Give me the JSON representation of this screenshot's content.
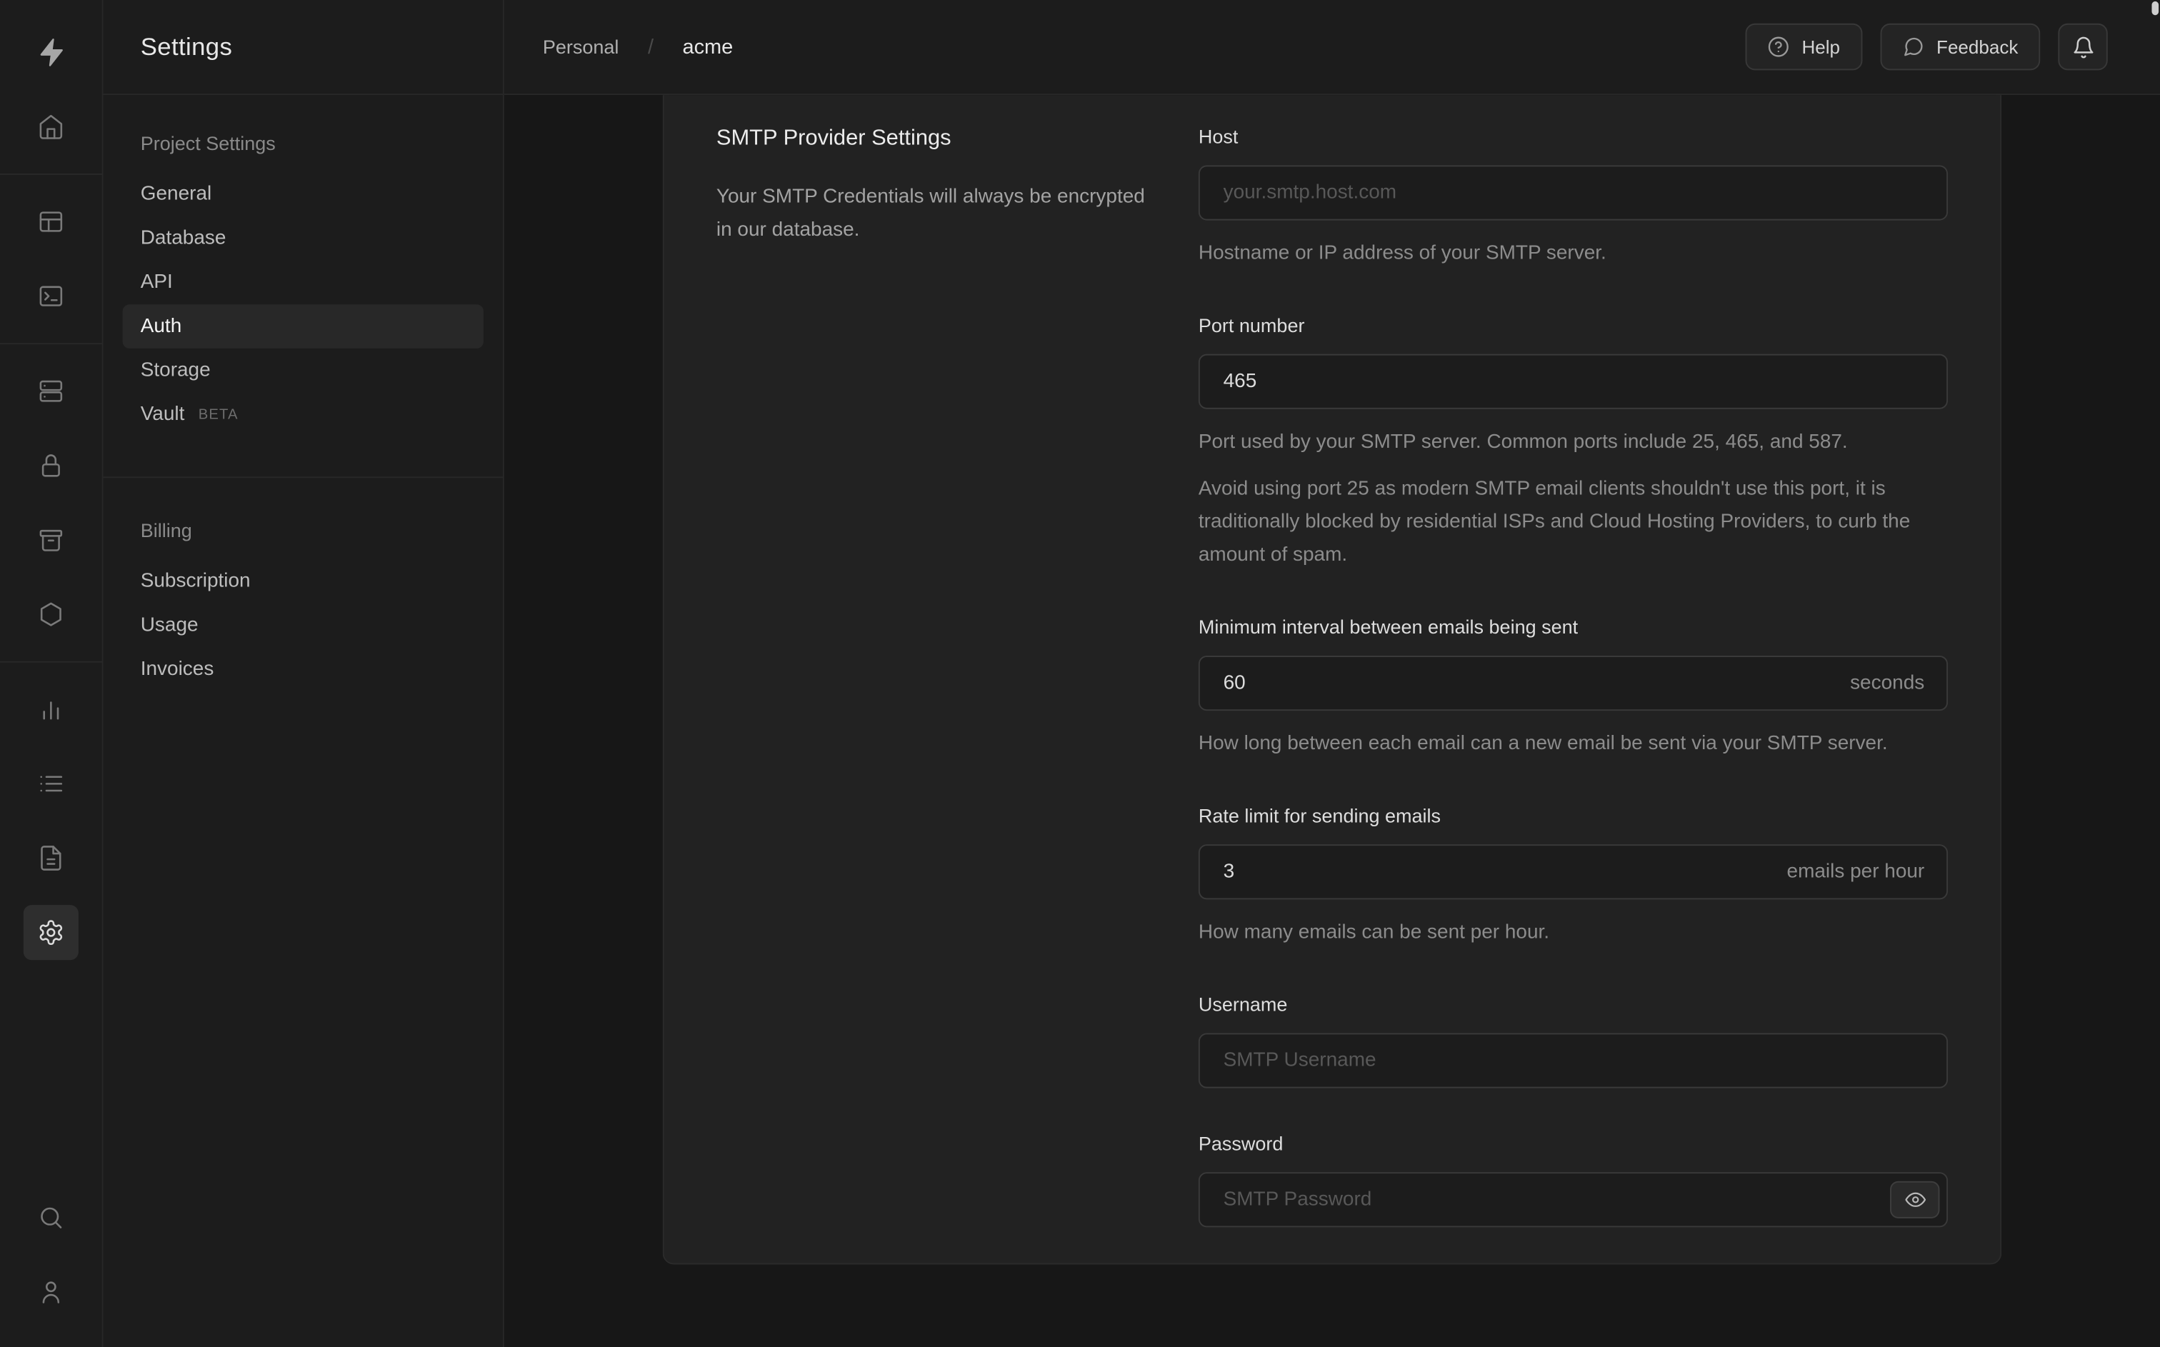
{
  "meta": {
    "app": "Supabase Dashboard",
    "page": "Project Settings - Auth - SMTP"
  },
  "colors": {
    "rail_bg": "#1c1c1c",
    "sidebar_bg": "#1c1c1c",
    "content_bg": "#171717",
    "card_bg": "#222222",
    "border": "#282828",
    "input_bg": "#1c1c1c",
    "input_border": "#3a3a3a",
    "text_primary": "#ececec",
    "text_muted": "#8c8c8c",
    "placeholder": "#585858",
    "active_item_bg": "#282828"
  },
  "rail": {
    "icons": [
      "supabase-logo",
      "home",
      "table-editor",
      "sql-editor",
      "database",
      "authentication",
      "storage",
      "edge-functions",
      "reports",
      "logs",
      "api-docs",
      "settings",
      "search",
      "user"
    ],
    "active": "settings"
  },
  "sidebar": {
    "title": "Settings",
    "sections": [
      {
        "label": "Project Settings",
        "items": [
          {
            "label": "General"
          },
          {
            "label": "Database"
          },
          {
            "label": "API"
          },
          {
            "label": "Auth",
            "active": true
          },
          {
            "label": "Storage"
          },
          {
            "label": "Vault",
            "badge": "BETA"
          }
        ]
      },
      {
        "label": "Billing",
        "items": [
          {
            "label": "Subscription"
          },
          {
            "label": "Usage"
          },
          {
            "label": "Invoices"
          }
        ]
      }
    ]
  },
  "header": {
    "breadcrumb": {
      "org": "Personal",
      "separator": "/",
      "project": "acme"
    },
    "actions": {
      "help": "Help",
      "feedback": "Feedback",
      "notifications_icon": "bell"
    }
  },
  "panel": {
    "title": "SMTP Provider Settings",
    "description": "Your SMTP Credentials will always be encrypted in our database.",
    "fields": {
      "host": {
        "label": "Host",
        "placeholder": "your.smtp.host.com",
        "help": "Hostname or IP address of your SMTP server."
      },
      "port": {
        "label": "Port number",
        "value": "465",
        "help": "Port used by your SMTP server. Common ports include 25, 465, and 587.",
        "note": "Avoid using port 25 as modern SMTP email clients shouldn't use this port, it is traditionally blocked by residential ISPs and Cloud Hosting Providers, to curb the amount of spam."
      },
      "interval": {
        "label": "Minimum interval between emails being sent",
        "value": "60",
        "unit": "seconds",
        "help": "How long between each email can a new email be sent via your SMTP server."
      },
      "rate_limit": {
        "label": "Rate limit for sending emails",
        "value": "3",
        "unit": "emails per hour",
        "help": "How many emails can be sent per hour."
      },
      "username": {
        "label": "Username",
        "placeholder": "SMTP Username"
      },
      "password": {
        "label": "Password",
        "placeholder": "SMTP Password",
        "reveal_icon": "eye"
      }
    }
  }
}
